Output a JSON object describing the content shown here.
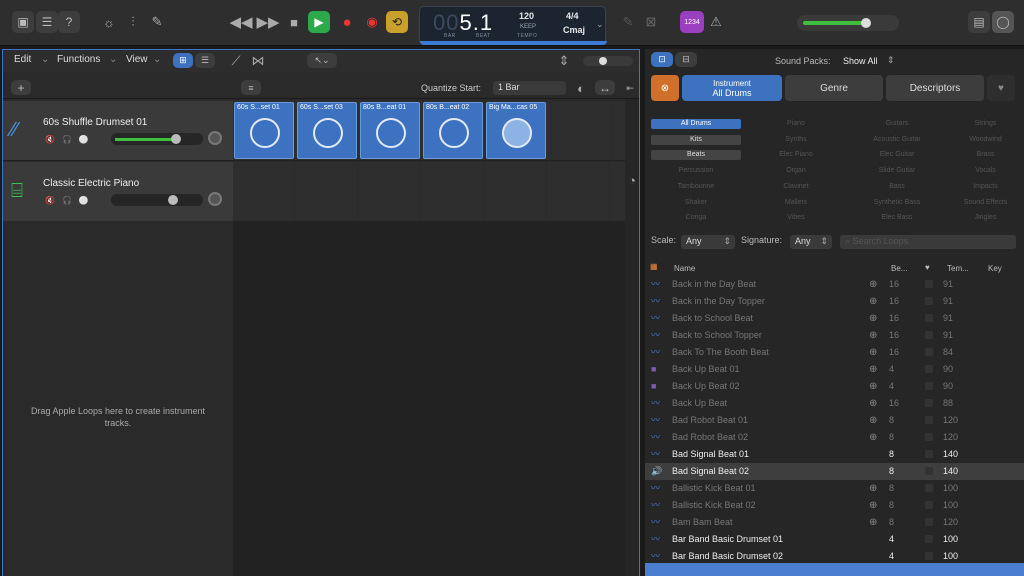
{
  "toolbar": {
    "lcd": {
      "bar_dim": "00",
      "position": "5.1",
      "bar_label": "BAR",
      "beat_label": "BEAT",
      "tempo": "120",
      "keep": "KEEP",
      "tempo_label": "TEMPO",
      "signature": "4/4",
      "key": "Cmaj"
    },
    "badge": "1234"
  },
  "tracks_area": {
    "menus": [
      "Edit",
      "Functions",
      "View"
    ],
    "quantize_label": "Quantize Start:",
    "quantize_value": "1 Bar",
    "tracks": [
      {
        "name": "60s Shuffle Drumset 01",
        "volume": 0.72
      },
      {
        "name": "Classic Electric Piano",
        "volume": 0.68
      }
    ],
    "regions": [
      "60s S...set 01",
      "60s S...set 03",
      "80s B...eat 01",
      "80s B...eat 02",
      "Big Ma...cas 05"
    ],
    "drop_text": "Drag Apple Loops here to create instrument tracks."
  },
  "browser": {
    "sound_packs_label": "Sound Packs:",
    "sound_packs_value": "Show All",
    "tabs": {
      "instrument_line1": "Instrument",
      "instrument_line2": "All Drums",
      "genre": "Genre",
      "descriptors": "Descriptors"
    },
    "categories": [
      [
        "All Drums",
        "Piano",
        "Guitars",
        "Strings"
      ],
      [
        "Kits",
        "Synths",
        "Acoustic Guitar",
        "Woodwind"
      ],
      [
        "Beats",
        "Elec Piano",
        "Elec Guitar",
        "Brass"
      ],
      [
        "Percussion",
        "Organ",
        "Slide Guitar",
        "Vocals"
      ],
      [
        "Tambourine",
        "Clavinet",
        "Bass",
        "Impacts"
      ],
      [
        "Shaker",
        "Mallets",
        "Synthetic Bass",
        "Sound Effects"
      ],
      [
        "Conga",
        "Vibes",
        "Elec Bass",
        "Jingles"
      ]
    ],
    "scale_label": "Scale:",
    "scale_value": "Any",
    "signature_label": "Signature:",
    "signature_value": "Any",
    "search_placeholder": "Search Loops",
    "columns": {
      "name": "Name",
      "beats": "Be...",
      "tempo": "Tem...",
      "key": "Key"
    },
    "rows": [
      {
        "name": "Back in the Day Beat",
        "beats": "16",
        "tempo": "91",
        "state": "dim"
      },
      {
        "name": "Back in the Day Topper",
        "beats": "16",
        "tempo": "91",
        "state": "dim"
      },
      {
        "name": "Back to School Beat",
        "beats": "16",
        "tempo": "91",
        "state": "dim"
      },
      {
        "name": "Back to School Topper",
        "beats": "16",
        "tempo": "91",
        "state": "dim"
      },
      {
        "name": "Back To The Booth Beat",
        "beats": "16",
        "tempo": "84",
        "state": "dim"
      },
      {
        "name": "Back Up Beat 01",
        "beats": "4",
        "tempo": "90",
        "state": "dim"
      },
      {
        "name": "Back Up Beat 02",
        "beats": "4",
        "tempo": "90",
        "state": "dim"
      },
      {
        "name": "Back Up Beat",
        "beats": "16",
        "tempo": "88",
        "state": "dim"
      },
      {
        "name": "Bad Robot Beat 01",
        "beats": "8",
        "tempo": "120",
        "state": "dim"
      },
      {
        "name": "Bad Robot Beat 02",
        "beats": "8",
        "tempo": "120",
        "state": "dim"
      },
      {
        "name": "Bad Signal Beat 01",
        "beats": "8",
        "tempo": "140",
        "state": "bright"
      },
      {
        "name": "Bad Signal Beat 02",
        "beats": "8",
        "tempo": "140",
        "state": "playing"
      },
      {
        "name": "Ballistic Kick Beat 01",
        "beats": "8",
        "tempo": "100",
        "state": "dim"
      },
      {
        "name": "Ballistic Kick Beat 02",
        "beats": "8",
        "tempo": "100",
        "state": "dim"
      },
      {
        "name": "Bam Bam Beat",
        "beats": "8",
        "tempo": "120",
        "state": "dim"
      },
      {
        "name": "Bar Band Basic Drumset 01",
        "beats": "4",
        "tempo": "100",
        "state": "bright"
      },
      {
        "name": "Bar Band Basic Drumset 02",
        "beats": "4",
        "tempo": "100",
        "state": "bright"
      }
    ]
  }
}
